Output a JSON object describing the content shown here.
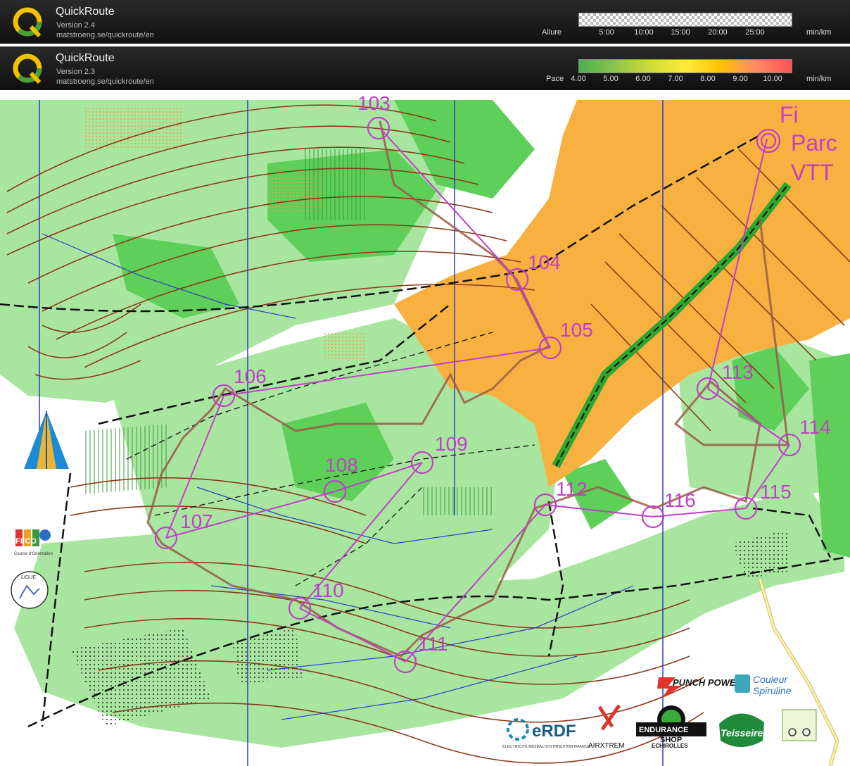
{
  "app_bar_top": {
    "name": "QuickRoute",
    "version": "Version 2.4",
    "url": "matstroeng.se/quickroute/en",
    "scale_label": "Allure",
    "unit": "min/km",
    "ticks": [
      "5:00",
      "10:00",
      "15:00",
      "20:00",
      "25:00"
    ]
  },
  "app_bar_bottom": {
    "name": "QuickRoute",
    "version": "Version 2.3",
    "url": "matstroeng.se/quickroute/en",
    "scale_label": "Pace",
    "unit": "min/km",
    "ticks": [
      "4.00",
      "5.00",
      "6.00",
      "7.00",
      "8.00",
      "9.00",
      "10.00"
    ],
    "gradient_colors": [
      "#4caf50",
      "#8bc34a",
      "#cddc39",
      "#ffeb3b",
      "#ffc107",
      "#ff8a65",
      "#ff5252"
    ]
  },
  "map": {
    "controls": [
      {
        "label": "103"
      },
      {
        "label": "104"
      },
      {
        "label": "105"
      },
      {
        "label": "106"
      },
      {
        "label": "107"
      },
      {
        "label": "108"
      },
      {
        "label": "109"
      },
      {
        "label": "110"
      },
      {
        "label": "111"
      },
      {
        "label": "112"
      },
      {
        "label": "113"
      },
      {
        "label": "114"
      },
      {
        "label": "115"
      },
      {
        "label": "116"
      }
    ],
    "finish_text": [
      "Fi",
      "Parc",
      "VTT"
    ],
    "colors": {
      "forest_green": "#5ed05a",
      "light_green": "#a8e6a0",
      "open_orange": "#f8b040",
      "contour_brown": "#8b3a1a",
      "course_magenta": "#c23ec8",
      "route_brown": "#9a5a4a",
      "water_blue": "#2b3fc4"
    }
  },
  "sponsors": {
    "ffco": "FFCO",
    "ffco_sub": "Course d'Orientation",
    "ligue": "LIGUE",
    "punch_power": "PUNCH POWER",
    "couleur_spiruline_1": "Couleur",
    "couleur_spiruline_2": "Spiruline",
    "erdf": "eRDF",
    "erdf_sub": "ÉLECTRICITÉ RÉSEAU DISTRIBUTION FRANCE",
    "airxtrem": "AIRXTREM",
    "endurance_1": "ENDURANCE",
    "endurance_2": "SHOP",
    "endurance_3": "ECHIROLLES",
    "teisseire": "Teisseire"
  }
}
